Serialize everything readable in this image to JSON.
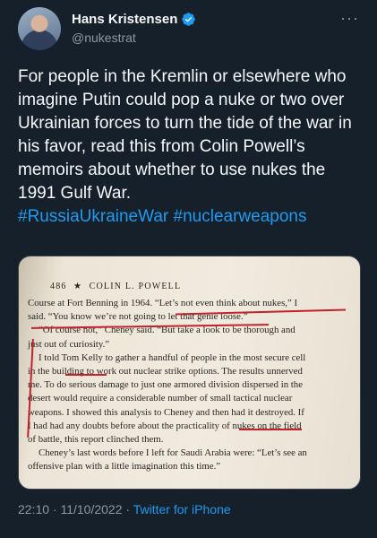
{
  "author": {
    "display_name": "Hans Kristensen",
    "handle": "@nukestrat"
  },
  "more_label": "···",
  "tweet": {
    "text": "For people in the Kremlin or elsewhere who imagine Putin could pop a nuke or two over Ukrainian forces to turn the tide of the war in his favor, read this from Colin Powell’s memoirs about whether to use nukes the 1991 Gulf War.",
    "hashtag_1": "#RussiaUkraineWar",
    "hashtag_2": "#nuclearweapons"
  },
  "book_page": {
    "page_number": "486",
    "star": "★",
    "header": "COLIN L. POWELL",
    "lines": [
      "Course at Fort Benning in 1964. “Let’s not even think about nukes,” I",
      "said. “You know we’re not going to let that genie loose.”",
      "“Of course not,” Cheney said. “But take a look to be thorough and",
      "just out of curiosity.”",
      "I told Tom Kelly to gather a handful of people in the most secure cell",
      "in the building to work out nuclear strike options. The results unnerved",
      "me. To do serious damage to just one armored division dispersed in the",
      "desert would require a considerable number of small tactical nuclear",
      "weapons. I showed this analysis to Cheney and then had it destroyed. If",
      "I had had any doubts before about the practicality of nukes on the field",
      "of battle, this report clinched them.",
      "Cheney’s last words before I left for Saudi Arabia were: “Let’s see an",
      "offensive plan with a little imagination this time.”"
    ]
  },
  "footer": {
    "time": "22:10 · 11/10/2022 · ",
    "source": "Twitter for iPhone"
  },
  "colors": {
    "background": "#15202b",
    "link": "#1d9bf0",
    "verified": "#1d9bf0",
    "underline": "#c2222b"
  }
}
